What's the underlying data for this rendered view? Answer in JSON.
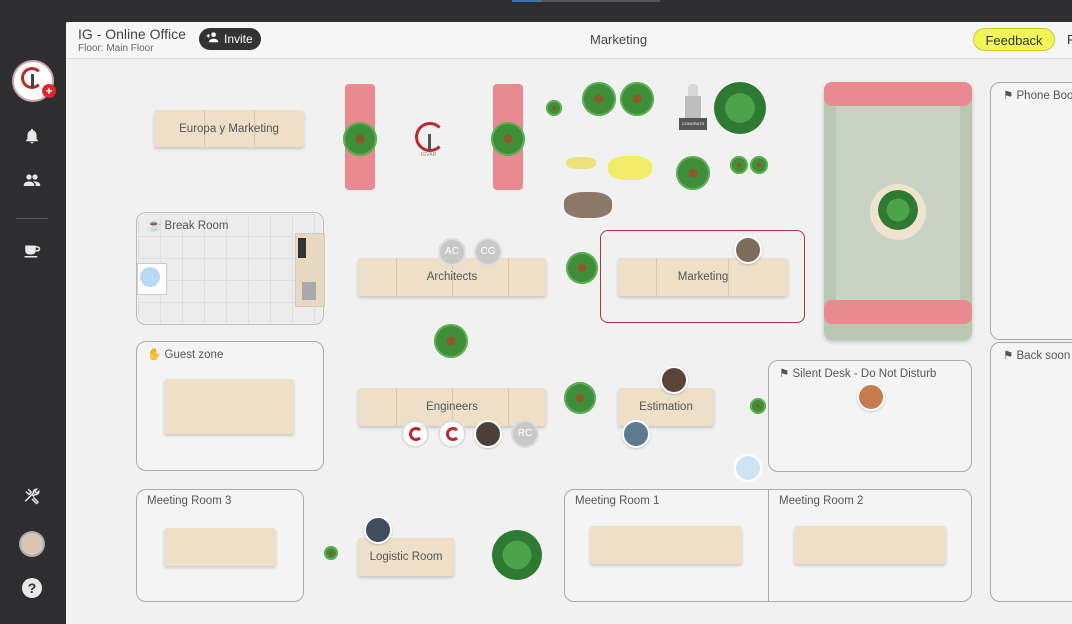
{
  "header": {
    "office_title": "IG - Online Office",
    "floor": "Floor: Main Floor",
    "invite_label": "Invite",
    "current_room": "Marketing",
    "feedback_label": "Feedback",
    "cut_text": "F"
  },
  "sidebar": {
    "icons": [
      "bell-icon",
      "people-icon",
      "coffee-icon",
      "tools-icon",
      "help-icon"
    ],
    "help_glyph": "?"
  },
  "logo_text": "IGVAR",
  "trophy_text": "CONGRATS",
  "zones": {
    "break_room": "Break Room",
    "guest_zone": "Guest zone",
    "meeting_room_3": "Meeting Room 3",
    "meeting_room_1": "Meeting Room 1",
    "meeting_room_2": "Meeting Room 2",
    "silent_desk": "Silent Desk - Do Not Disturb",
    "phone_booth": "Phone Boo",
    "back_soon": "Back soon"
  },
  "tables": {
    "europa": "Europa y Marketing",
    "architects": "Architects",
    "marketing": "Marketing",
    "engineers": "Engineers",
    "estimation": "Estimation",
    "logistic": "Logistic Room"
  },
  "initials": {
    "ac": "AC",
    "cg": "CG",
    "rc": "RC"
  },
  "colors": {
    "accent_red": "#c0272d",
    "feedback_yellow": "#f2f558",
    "sidebar_bg": "#2e2e30",
    "canvas_bg": "#f1f1f1",
    "sofa_pink": "#e98a91",
    "table_wood": "#eddfc8",
    "selected_border": "#a33a3a"
  }
}
